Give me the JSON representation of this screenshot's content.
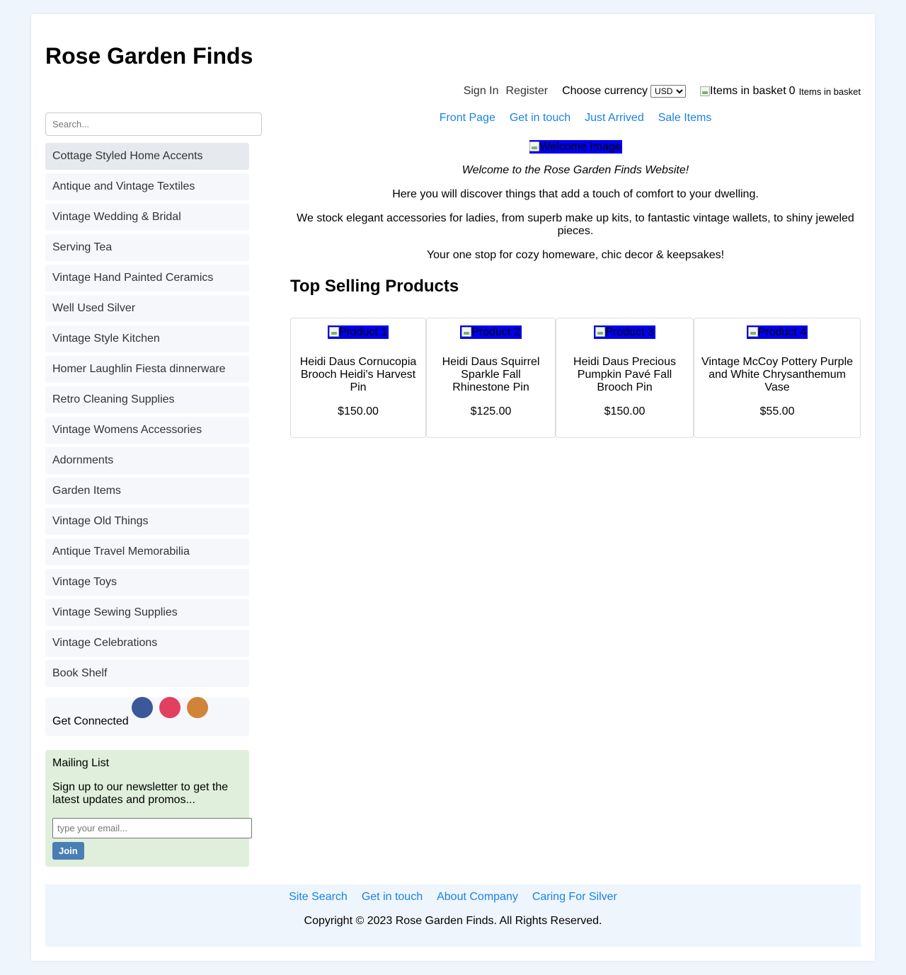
{
  "site": {
    "title": "Rose Garden Finds"
  },
  "topbar": {
    "sign_in": "Sign In",
    "register": "Register",
    "currency_label": "Choose currency",
    "currency_selected": "USD",
    "basket_img_alt": "Items in basket",
    "basket_count": "0",
    "basket_label": "Items in basket"
  },
  "sidebar": {
    "search_placeholder": "Search...",
    "categories": [
      "Cottage Styled Home Accents",
      "Antique and Vintage Textiles",
      "Vintage Wedding & Bridal",
      "Serving Tea",
      "Vintage Hand Painted Ceramics",
      "Well Used Silver",
      "Vintage Style Kitchen",
      "Homer Laughlin Fiesta dinnerware",
      "Retro Cleaning Supplies",
      "Vintage Womens Accessories",
      "Adornments",
      "Garden Items",
      "Vintage Old Things",
      "Antique Travel Memorabilia",
      "Vintage Toys",
      "Vintage Sewing Supplies",
      "Vintage Celebrations",
      "Book Shelf"
    ],
    "connect_label": "Get Connected",
    "social": [
      {
        "name": "facebook-icon",
        "color": "#3b5998"
      },
      {
        "name": "instagram-icon",
        "color": "#e1405f"
      },
      {
        "name": "etsy-icon",
        "color": "#d0843a"
      }
    ],
    "mailing": {
      "title": "Mailing List",
      "text": "Sign up to our newsletter to get the latest updates and promos...",
      "email_placeholder": "type your email...",
      "join_label": "Join"
    }
  },
  "nav": [
    "Front Page",
    "Get in touch",
    "Just Arrived",
    "Sale Items"
  ],
  "intro": {
    "welcome_img_alt": "Welcome Image",
    "lead": "Welcome to the Rose Garden Finds Website!",
    "p2": "Here you will discover things that add a touch of comfort to your dwelling.",
    "p3": "We stock elegant accessories for ladies, from superb make up kits, to fantastic vintage wallets, to shiny jeweled pieces.",
    "p4": "Your one stop for cozy homeware, chic decor & keepsakes!"
  },
  "top_selling": {
    "title": "Top Selling Products",
    "products": [
      {
        "img_alt": "Product 1",
        "name": "Heidi Daus Cornucopia Brooch Heidi's Harvest Pin",
        "price": "$150.00"
      },
      {
        "img_alt": "Product 2",
        "name": "Heidi Daus Squirrel Sparkle Fall Rhinestone Pin",
        "price": "$125.00"
      },
      {
        "img_alt": "Product 3",
        "name": "Heidi Daus Precious Pumpkin Pavé Fall Brooch Pin",
        "price": "$150.00"
      },
      {
        "img_alt": "Product 4",
        "name": "Vintage McCoy Pottery Purple and White Chrysanthemum Vase",
        "price": "$55.00"
      }
    ]
  },
  "footer": {
    "links": [
      "Site Search",
      "Get in touch",
      "About Company",
      "Caring For Silver"
    ],
    "copyright": "Copyright © 2023 Rose Garden Finds. All Rights Reserved."
  }
}
